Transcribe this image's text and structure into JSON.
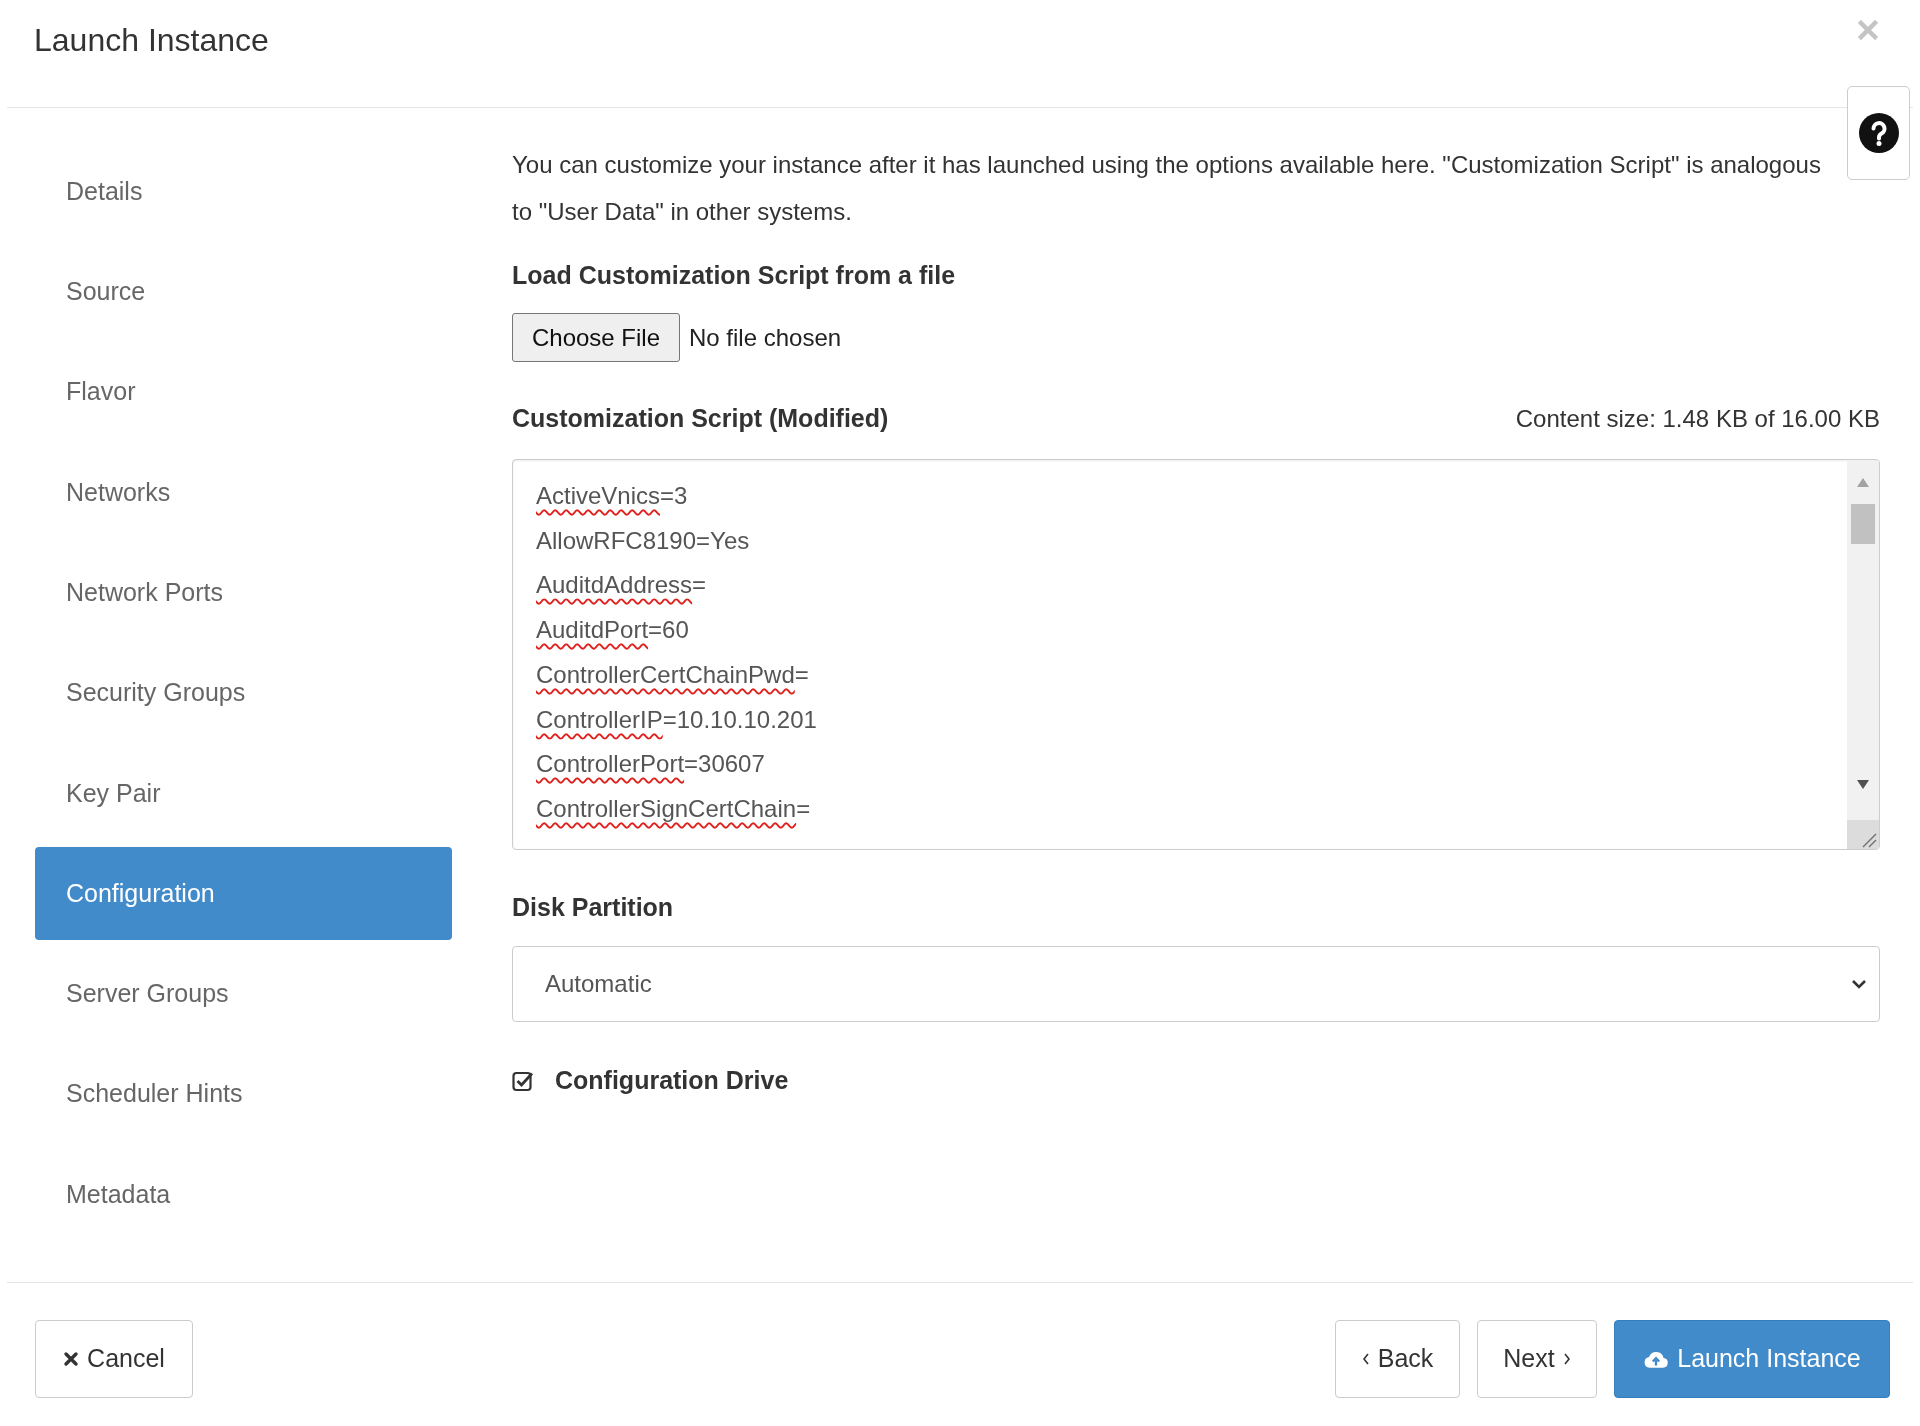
{
  "dialog": {
    "title": "Launch Instance"
  },
  "sidebar": {
    "items": [
      {
        "label": "Details",
        "selected": false
      },
      {
        "label": "Source",
        "selected": false
      },
      {
        "label": "Flavor",
        "selected": false
      },
      {
        "label": "Networks",
        "selected": false
      },
      {
        "label": "Network Ports",
        "selected": false
      },
      {
        "label": "Security Groups",
        "selected": false
      },
      {
        "label": "Key Pair",
        "selected": false
      },
      {
        "label": "Configuration",
        "selected": true
      },
      {
        "label": "Server Groups",
        "selected": false
      },
      {
        "label": "Scheduler Hints",
        "selected": false
      },
      {
        "label": "Metadata",
        "selected": false
      }
    ]
  },
  "configuration": {
    "description": "You can customize your instance after it has launched using the options available here. \"Customization Script\" is analogous to \"User Data\" in other systems.",
    "file_upload": {
      "label": "Load Customization Script from a file",
      "button": "Choose File",
      "status": "No file chosen"
    },
    "script": {
      "label": "Customization Script (Modified)",
      "content_size": "Content size: 1.48 KB of 16.00 KB",
      "lines": [
        {
          "text": "ActiveVnics=3",
          "misspelled": true
        },
        {
          "text": "AllowRFC8190=Yes",
          "misspelled": false
        },
        {
          "text": "AuditdAddress=",
          "misspelled": true
        },
        {
          "text": "AuditdPort=60",
          "misspelled": true
        },
        {
          "text": "ControllerCertChainPwd=",
          "misspelled": true
        },
        {
          "text": "ControllerIP=10.10.10.201",
          "misspelled": true
        },
        {
          "text": "ControllerPort=30607",
          "misspelled": true
        },
        {
          "text": "ControllerSignCertChain=",
          "misspelled": true
        }
      ]
    },
    "disk_partition": {
      "label": "Disk Partition",
      "value": "Automatic"
    },
    "configuration_drive": {
      "label": "Configuration Drive",
      "checked": true
    }
  },
  "footer": {
    "buttons": [
      {
        "label": "Cancel",
        "kind": "cancel"
      },
      {
        "label": "Back",
        "kind": "back"
      },
      {
        "label": "Next",
        "kind": "next"
      },
      {
        "label": "Launch Instance",
        "kind": "launch"
      }
    ]
  }
}
